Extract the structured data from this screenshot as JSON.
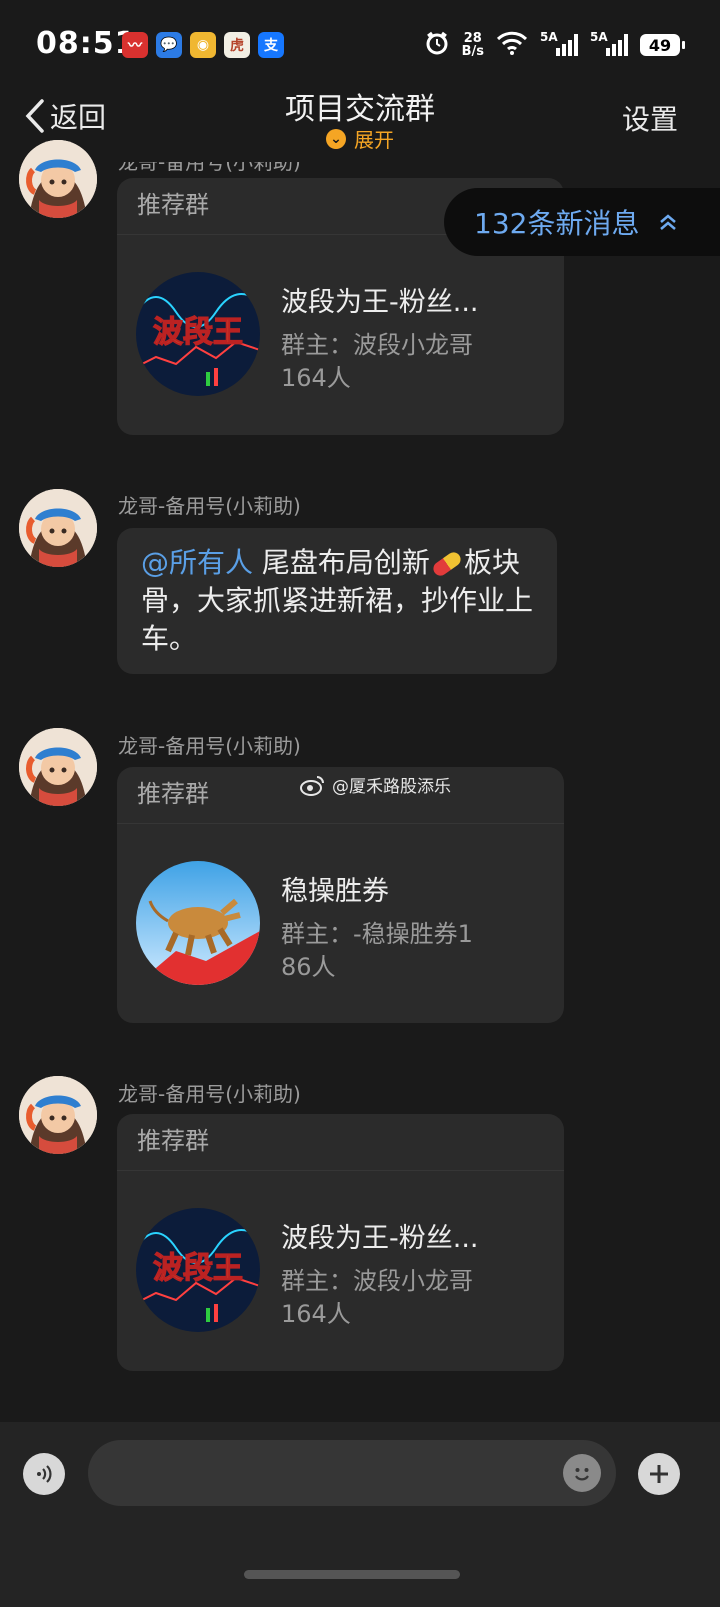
{
  "status_bar": {
    "time": "08:51",
    "net_speed_value": "28",
    "net_speed_unit": "B/s",
    "signal_1": "5A",
    "signal_2": "5A",
    "battery": "49"
  },
  "header": {
    "back_label": "返回",
    "title": "项目交流群",
    "expand_label": "展开",
    "settings_label": "设置"
  },
  "new_messages": {
    "label": "132条新消息"
  },
  "messages": [
    {
      "sender": "龙哥-备用号(小莉助)",
      "card_label": "推荐群",
      "group_name": "波段为王-粉丝...",
      "owner": "群主：波段小龙哥",
      "count": "164人",
      "image_text": "波段王"
    },
    {
      "sender": "龙哥-备用号(小莉助)",
      "mention": "@所有人",
      "text_part1": "尾盘布局创新",
      "text_part2": "板块骨，大家抓紧进新裙，抄作业上车。"
    },
    {
      "sender": "龙哥-备用号(小莉助)",
      "card_label": "推荐群",
      "group_name": "稳操胜券",
      "owner": "群主：-稳操胜券1",
      "count": "86人"
    },
    {
      "sender": "龙哥-备用号(小莉助)",
      "card_label": "推荐群",
      "group_name": "波段为王-粉丝...",
      "owner": "群主：波段小龙哥",
      "count": "164人",
      "image_text": "波段王"
    }
  ],
  "watermark": "@厦禾路股添乐",
  "colors": {
    "background": "#1a1a1a",
    "bubble": "#2b2b2b",
    "accent_orange": "#f5a524",
    "link_blue": "#5a9fe6"
  }
}
